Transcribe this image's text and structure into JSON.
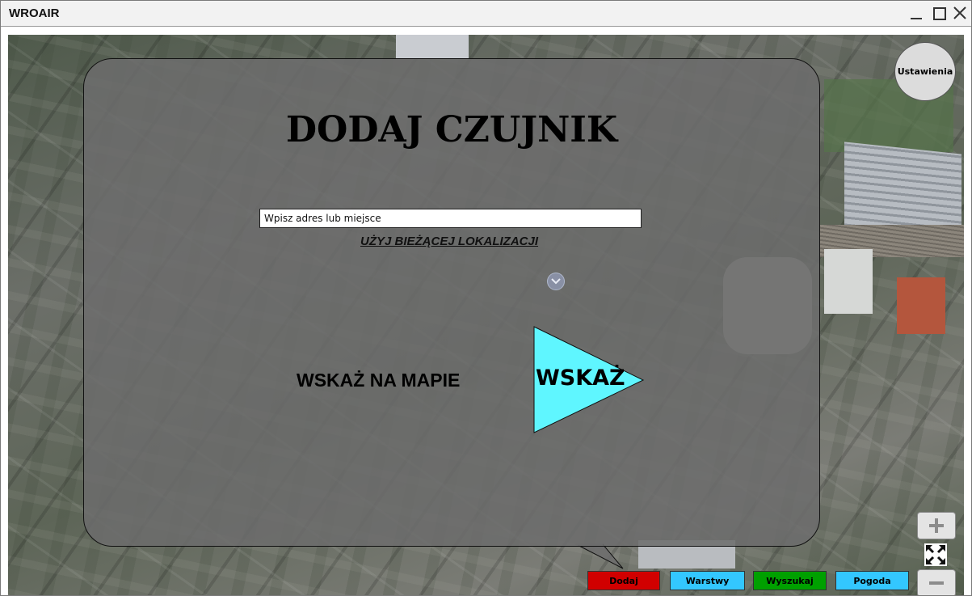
{
  "window": {
    "title": "WROAIR"
  },
  "panel": {
    "title": "DODAJ CZUJNIK",
    "address_placeholder": "Wpisz adres lub miejsce",
    "use_location_label": "UŻYJ BIEŻĄCEJ LOKALIZACJI",
    "pick_on_map_label": "WSKAŻ NA MAPIE",
    "pick_button_label": "WSKAŻ"
  },
  "settings": {
    "label": "Ustawienia"
  },
  "bottom_bar": {
    "buttons": [
      {
        "label": "Dodaj",
        "color": "#d10000"
      },
      {
        "label": "Warstwy",
        "color": "#33c7ff"
      },
      {
        "label": "Wyszukaj",
        "color": "#00a000"
      },
      {
        "label": "Pogoda",
        "color": "#33c7ff"
      }
    ]
  },
  "map_controls": {
    "zoom_in_icon": "plus-icon",
    "zoom_out_icon": "minus-icon",
    "fullscreen_icon": "fullscreen-icon"
  },
  "colors": {
    "pick_button_fill": "#5ff6ff",
    "panel_overlay": "#6c6c6c"
  }
}
